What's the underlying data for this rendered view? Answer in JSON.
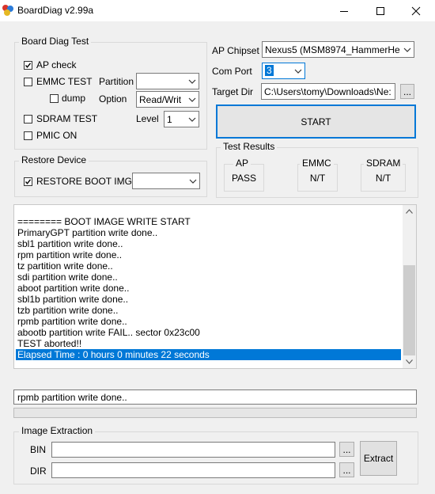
{
  "window": {
    "title": "BoardDiag v2.99a"
  },
  "board_diag": {
    "legend": "Board Diag Test",
    "ap_check": {
      "label": "AP check",
      "checked": true
    },
    "emmc_test": {
      "label": "EMMC TEST",
      "checked": false
    },
    "dump": {
      "label": "dump",
      "checked": false
    },
    "sdram_test": {
      "label": "SDRAM TEST",
      "checked": false
    },
    "pmic_on": {
      "label": "PMIC ON",
      "checked": false
    },
    "partition_label": "Partition",
    "partition_value": "",
    "option_label": "Option",
    "option_value": "Read/Writ",
    "level_label": "Level",
    "level_value": "1"
  },
  "settings": {
    "ap_chipset_label": "AP Chipset",
    "ap_chipset_value": "Nexus5 (MSM8974_HammerHe",
    "com_port_label": "Com Port",
    "com_port_value": "3",
    "target_dir_label": "Target Dir",
    "target_dir_value": "C:\\Users\\tomy\\Downloads\\Ne:",
    "browse_label": "..."
  },
  "start_label": "START",
  "restore": {
    "legend": "Restore Device",
    "restore_boot": {
      "label": "RESTORE BOOT IMG",
      "checked": true
    },
    "restore_value": ""
  },
  "results": {
    "legend": "Test Results",
    "ap": {
      "label": "AP",
      "value": "PASS"
    },
    "emmc": {
      "label": "EMMC",
      "value": "N/T"
    },
    "sdram": {
      "label": "SDRAM",
      "value": "N/T"
    }
  },
  "log": {
    "lines": [
      "======== BOOT IMAGE WRITE START",
      "PrimaryGPT partition write done..",
      "sbl1 partition write done..",
      "rpm partition write done..",
      "tz partition write done..",
      "sdi partition write done..",
      "aboot partition write done..",
      "sbl1b partition write done..",
      "tzb partition write done..",
      "rpmb partition write done..",
      "abootb partition write FAIL.. sector 0x23c00",
      "TEST aborted!!",
      "Elapsed Time : 0 hours 0 minutes 22 seconds"
    ],
    "selected_index": 12
  },
  "status_text": "rpmb partition write done..",
  "progress": 0,
  "image_extraction": {
    "legend": "Image Extraction",
    "bin_label": "BIN",
    "bin_value": "",
    "dir_label": "DIR",
    "dir_value": "",
    "browse_label": "...",
    "extract_label": "Extract"
  }
}
